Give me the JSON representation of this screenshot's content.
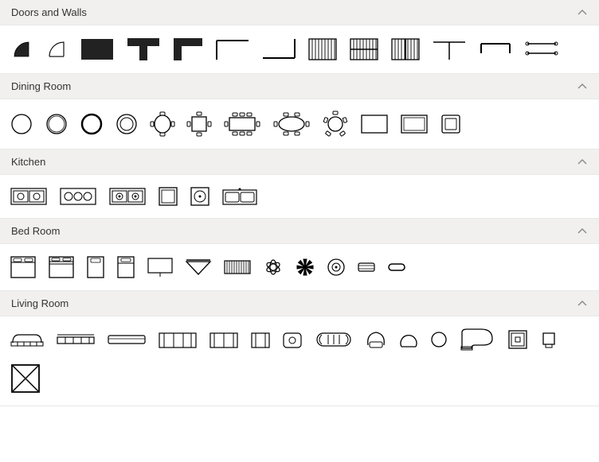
{
  "sections": [
    {
      "id": "doors-walls",
      "title": "Doors and Walls",
      "collapsed": false
    },
    {
      "id": "dining-room",
      "title": "Dining Room",
      "collapsed": false
    },
    {
      "id": "kitchen",
      "title": "Kitchen",
      "collapsed": false
    },
    {
      "id": "bed-room",
      "title": "Bed Room",
      "collapsed": false
    },
    {
      "id": "living-room",
      "title": "Living Room",
      "collapsed": false
    }
  ],
  "doors_walls_items": [
    "door-arc",
    "door-swing",
    "wall-solid",
    "wall-t-down",
    "wall-l-up",
    "wall-corner-tl",
    "wall-corner-br",
    "window-panel-1",
    "window-panel-2",
    "window-panel-3",
    "wall-t-line",
    "opening-bracket",
    "double-door-lines"
  ],
  "dining_room_items": [
    "table-round-1",
    "table-round-2",
    "table-round-3",
    "table-round-4",
    "table-round-chairs",
    "table-square-chairs",
    "table-rect-6-chairs",
    "table-oval-chairs",
    "table-round-5-chairs",
    "table-rect-plain",
    "table-rect-border",
    "table-square-hollow"
  ],
  "kitchen_items": [
    "stove-double-knobs",
    "stove-single-knobs",
    "stove-grill-double",
    "counter-square",
    "counter-sq-circle",
    "sink-double"
  ],
  "bed_room_items": [
    "bed-double",
    "bed-double-stripe",
    "bed-single-1",
    "bed-single-2",
    "desk",
    "lamp-triangle",
    "radiator",
    "fan-4",
    "fan-sharp",
    "ceiling-light",
    "rug-lines",
    "rug-oval"
  ],
  "living_room_items": [
    "sofa-modern-1",
    "sofa-modern-2",
    "sofa-modern-3",
    "sofa-3seat",
    "sofa-2seat",
    "armchair",
    "armchair-oval",
    "sofa-round-long",
    "armchair-bucket-1",
    "armchair-bucket-2",
    "round-ottoman",
    "piano-grand",
    "tv-set",
    "tv-small",
    "window-x"
  ]
}
